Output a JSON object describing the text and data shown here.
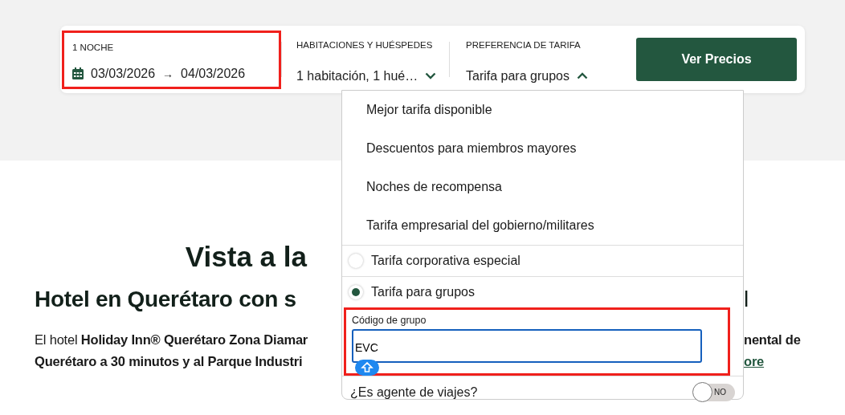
{
  "search_bar": {
    "dates": {
      "label": "1 NOCHE",
      "check_in": "03/03/2026",
      "arrow": "→",
      "check_out": "04/03/2026",
      "highlighted": true
    },
    "rooms": {
      "label": "HABITACIONES Y HUÉSPEDES",
      "value": "1 habitación, 1 hué…",
      "expanded": false
    },
    "rate": {
      "label": "PREFERENCIA DE TARIFA",
      "value": "Tarifa para grupos",
      "expanded": true
    },
    "submit": "Ver Precios"
  },
  "rate_menu": {
    "options": [
      {
        "kind": "option",
        "label": "Mejor tarifa disponible"
      },
      {
        "kind": "option",
        "label": "Descuentos para miembros mayores"
      },
      {
        "kind": "option",
        "label": "Noches de recompensa"
      },
      {
        "kind": "option",
        "label": "Tarifa empresarial del gobierno/militares"
      },
      {
        "kind": "radio",
        "label": "Tarifa corporativa especial",
        "selected": false
      },
      {
        "kind": "radio",
        "label": "Tarifa para grupos",
        "selected": true
      }
    ],
    "group_code": {
      "label": "Código de grupo",
      "value": "EVC",
      "highlighted": true
    },
    "travel_agent": {
      "label": "¿Es agente de viajes?",
      "on": false,
      "toggle_label": "NO"
    }
  },
  "content": {
    "heading": "Vista a la",
    "subheading_left": "Hotel en Querétaro con s",
    "subheading_right": "l",
    "paragraph_left": [
      {
        "text": "El hotel **Holiday Inn® Querétaro Zona Diamar**",
        "bold": false
      },
      {
        "text": "Querétaro a 30 minutos y al Parque Industri",
        "bold": true
      }
    ],
    "paragraph_right": {
      "text": "nental de",
      "bold": true
    },
    "link": "ore"
  }
}
